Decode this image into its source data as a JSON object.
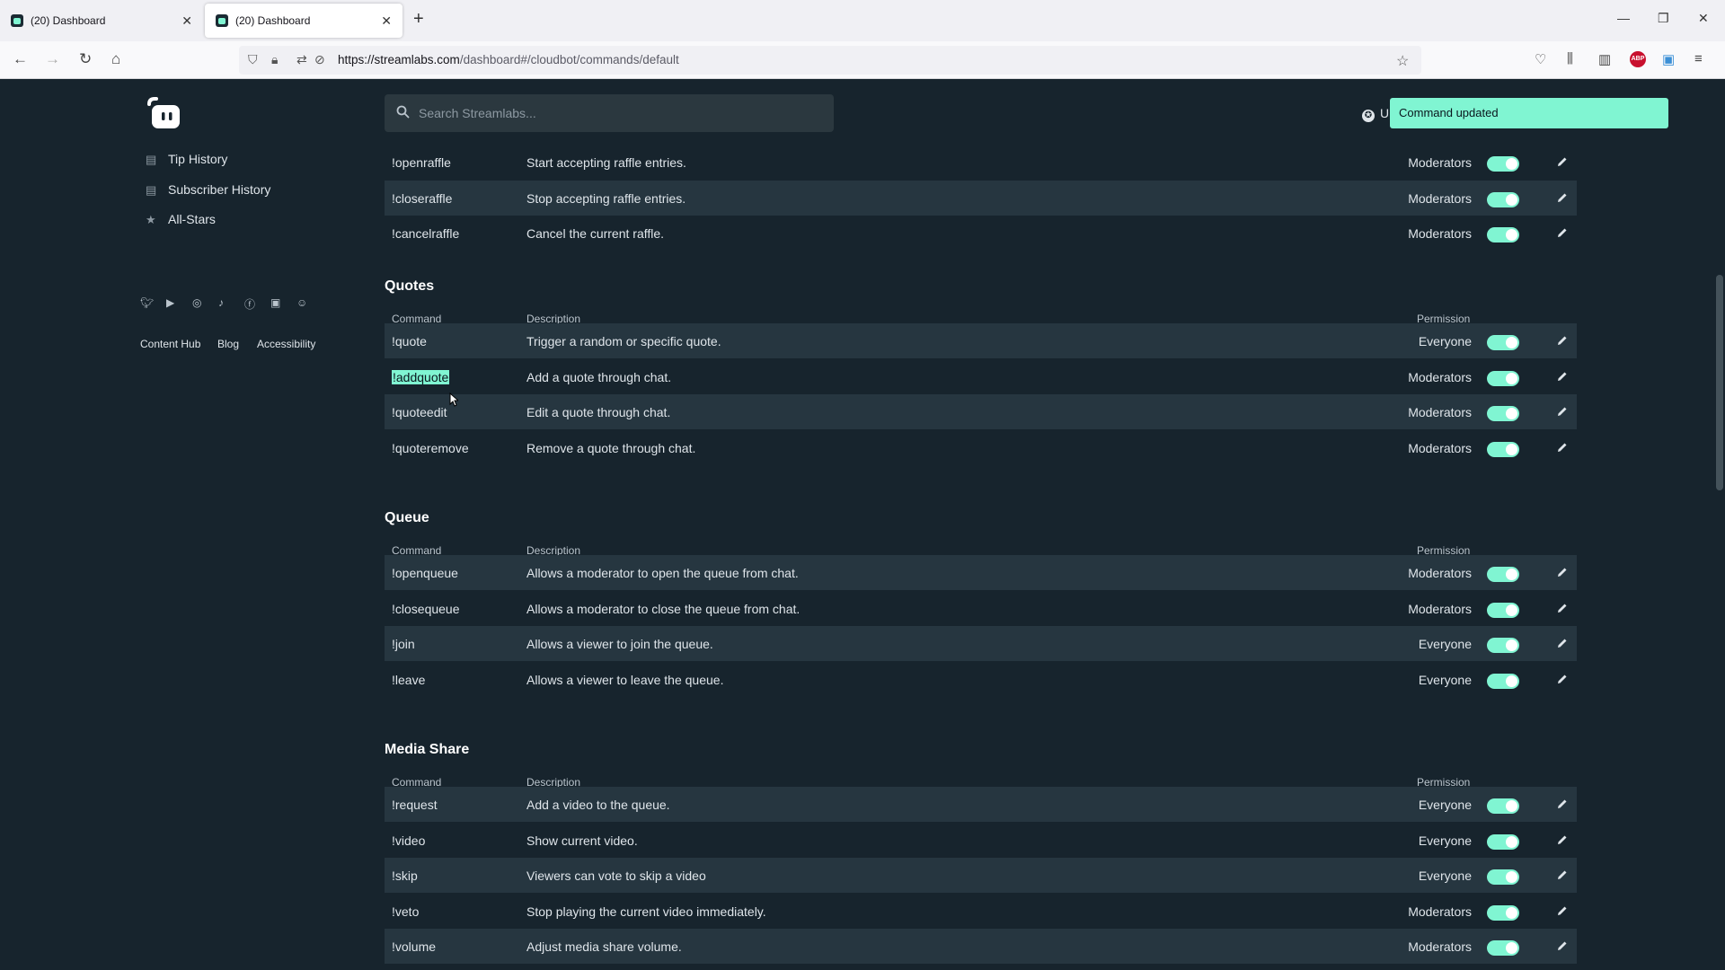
{
  "browser": {
    "tabs": [
      {
        "title": "(20) Dashboard",
        "close": "✕"
      },
      {
        "title": "(20) Dashboard",
        "close": "✕"
      }
    ],
    "new_tab": "+",
    "url_domain": "https://streamlabs.com",
    "url_path": "/dashboard#/cloudbot/commands/default",
    "window_controls": {
      "minimize": "—",
      "restore": "❐",
      "close": "✕"
    },
    "nav_icons": {
      "back": "←",
      "forward": "→",
      "reload": "↻",
      "home": "⌂"
    }
  },
  "sidebar": {
    "items": [
      {
        "label": "Tip History",
        "icon": "list-icon"
      },
      {
        "label": "Subscriber History",
        "icon": "list-icon"
      },
      {
        "label": "All-Stars",
        "icon": "star-icon"
      }
    ],
    "social_icons": [
      "twitter-icon",
      "youtube-icon",
      "instagram-icon",
      "tiktok-icon",
      "facebook-icon",
      "linkedin-icon",
      "discord-icon"
    ],
    "footer_links": [
      "Content Hub",
      "Blog",
      "Accessibility"
    ]
  },
  "header": {
    "search_placeholder": "Search Streamlabs...",
    "upgrade_label": "U",
    "toast": "Command updated"
  },
  "columns": {
    "command": "Command",
    "description": "Description",
    "permission": "Permission"
  },
  "raffle_rows": [
    {
      "cmd": "!openraffle",
      "desc": "Start accepting raffle entries.",
      "perm": "Moderators",
      "enabled": true
    },
    {
      "cmd": "!closeraffle",
      "desc": "Stop accepting raffle entries.",
      "perm": "Moderators",
      "enabled": true
    },
    {
      "cmd": "!cancelraffle",
      "desc": "Cancel the current raffle.",
      "perm": "Moderators",
      "enabled": true
    }
  ],
  "sections": [
    {
      "title": "Quotes",
      "rows": [
        {
          "cmd": "!quote",
          "desc": "Trigger a random or specific quote.",
          "perm": "Everyone",
          "enabled": true
        },
        {
          "cmd": "!addquote",
          "desc": "Add a quote through chat.",
          "perm": "Moderators",
          "enabled": true,
          "selected": true
        },
        {
          "cmd": "!quoteedit",
          "desc": "Edit a quote through chat.",
          "perm": "Moderators",
          "enabled": true
        },
        {
          "cmd": "!quoteremove",
          "desc": "Remove a quote through chat.",
          "perm": "Moderators",
          "enabled": true
        }
      ]
    },
    {
      "title": "Queue",
      "rows": [
        {
          "cmd": "!openqueue",
          "desc": "Allows a moderator to open the queue from chat.",
          "perm": "Moderators",
          "enabled": true
        },
        {
          "cmd": "!closequeue",
          "desc": "Allows a moderator to close the queue from chat.",
          "perm": "Moderators",
          "enabled": true
        },
        {
          "cmd": "!join",
          "desc": "Allows a viewer to join the queue.",
          "perm": "Everyone",
          "enabled": true
        },
        {
          "cmd": "!leave",
          "desc": "Allows a viewer to leave the queue.",
          "perm": "Everyone",
          "enabled": true
        }
      ]
    },
    {
      "title": "Media Share",
      "rows": [
        {
          "cmd": "!request",
          "desc": "Add a video to the queue.",
          "perm": "Everyone",
          "enabled": true
        },
        {
          "cmd": "!video",
          "desc": "Show current video.",
          "perm": "Everyone",
          "enabled": true
        },
        {
          "cmd": "!skip",
          "desc": "Viewers can vote to skip a video",
          "perm": "Everyone",
          "enabled": true
        },
        {
          "cmd": "!veto",
          "desc": "Stop playing the current video immediately.",
          "perm": "Moderators",
          "enabled": true
        },
        {
          "cmd": "!volume",
          "desc": "Adjust media share volume.",
          "perm": "Moderators",
          "enabled": true
        }
      ]
    }
  ],
  "colors": {
    "accent": "#80f5d2",
    "background": "#17242d",
    "row_alt": "#263640"
  }
}
